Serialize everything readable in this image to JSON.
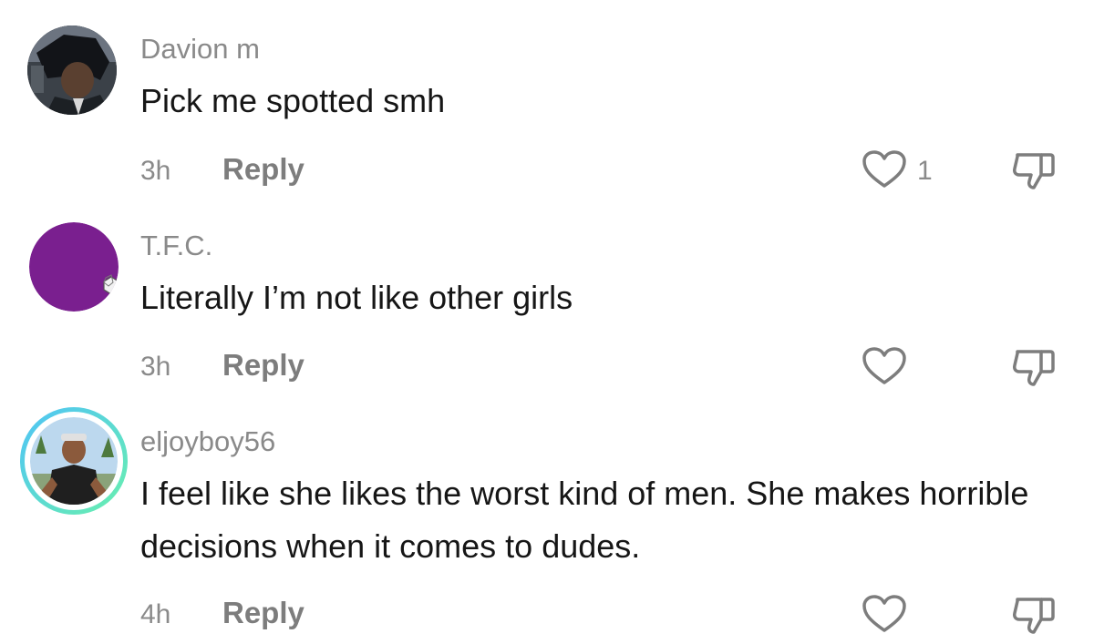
{
  "comments": [
    {
      "username": "Davion m",
      "text": "Pick me spotted smh",
      "time": "3h",
      "reply_label": "Reply",
      "like_count": "1",
      "avatar_icon": "anime-character-avatar"
    },
    {
      "username": "T.F.C.",
      "text": "Literally I’m not like other girls",
      "time": "3h",
      "reply_label": "Reply",
      "like_count": "",
      "avatar_icon": "purple-avatar-with-dice",
      "avatar_color": "#7a1f8f"
    },
    {
      "username": "eljoyboy56",
      "text": "I feel like she likes the worst kind of men. She makes horrible decisions when it comes to dudes.",
      "time": "4h",
      "reply_label": "Reply",
      "like_count": "",
      "avatar_icon": "photo-avatar-with-story-ring"
    }
  ],
  "colors": {
    "text_primary": "#161616",
    "text_secondary": "#8a8a8a",
    "story_ring_start": "#4fc3f7",
    "story_ring_end": "#69f0ae"
  },
  "icons": {
    "like": "heart-outline-icon",
    "dislike": "thumbs-down-icon"
  }
}
